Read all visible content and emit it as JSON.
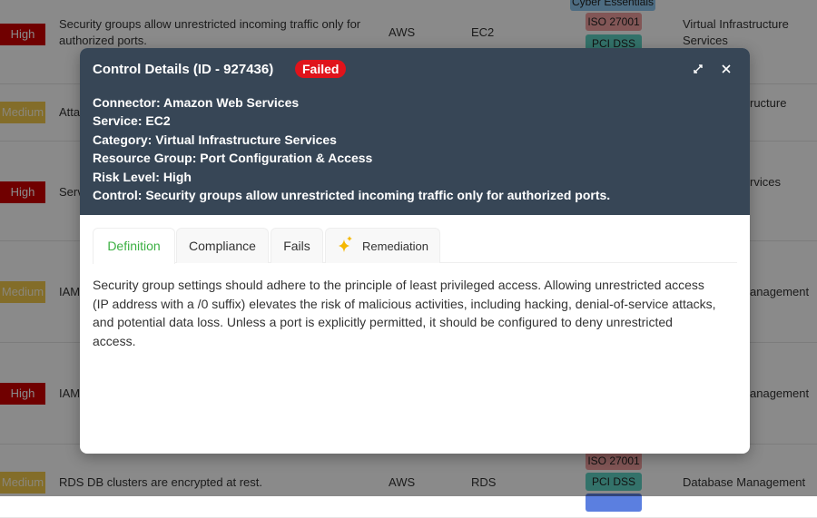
{
  "background_rows": [
    {
      "severity": "High",
      "severity_class": "high",
      "title": "Security groups allow unrestricted incoming traffic only for authorized ports.",
      "connector": "AWS",
      "service": "EC2",
      "category": "Virtual Infrastructure Services",
      "tags": [
        "Cyber Essentials",
        "ISO 27001",
        "PCI DSS"
      ]
    },
    {
      "severity": "Medium",
      "severity_class": "medium",
      "title": "Atta",
      "category": "ructure"
    },
    {
      "severity": "High",
      "severity_class": "high",
      "title": "Serv",
      "category": "rvices"
    },
    {
      "severity": "Medium",
      "severity_class": "medium",
      "title": "IAM",
      "category": "anagement"
    },
    {
      "severity": "High",
      "severity_class": "high",
      "title": "IAM",
      "category": "anagement"
    },
    {
      "severity": "Medium",
      "severity_class": "medium",
      "title": "RDS DB clusters are encrypted at rest.",
      "connector": "AWS",
      "service": "RDS",
      "category": "Database Management",
      "tags": [
        "ISO 27001",
        "PCI DSS"
      ]
    }
  ],
  "modal": {
    "title": "Control Details (ID - 927436)",
    "status": "Failed",
    "status_color": "#e0131b",
    "header_color": "#374656",
    "expand_icon": "expand-icon",
    "close_icon": "close-icon",
    "meta": [
      "Connector: Amazon Web Services",
      "Service: EC2",
      "Category: Virtual Infrastructure Services",
      "Resource Group: Port Configuration & Access",
      "Risk Level: High",
      "Control: Security groups allow unrestricted incoming traffic only for authorized ports."
    ],
    "tabs": [
      {
        "label": "Definition",
        "active": true
      },
      {
        "label": "Compliance"
      },
      {
        "label": "Fails"
      },
      {
        "label": "Remediation",
        "icon": "sparkle-icon"
      }
    ],
    "accent_color": "#3cb043",
    "definition": "Security group settings should adhere to the principle of least privileged access. Allowing unrestricted access (IP address with a /0 suffix) elevates the risk of malicious activities, including hacking, denial-of-service attacks, and potential data loss. Unless a port is explicitly permitted, it should be configured to deny unrestricted access."
  }
}
